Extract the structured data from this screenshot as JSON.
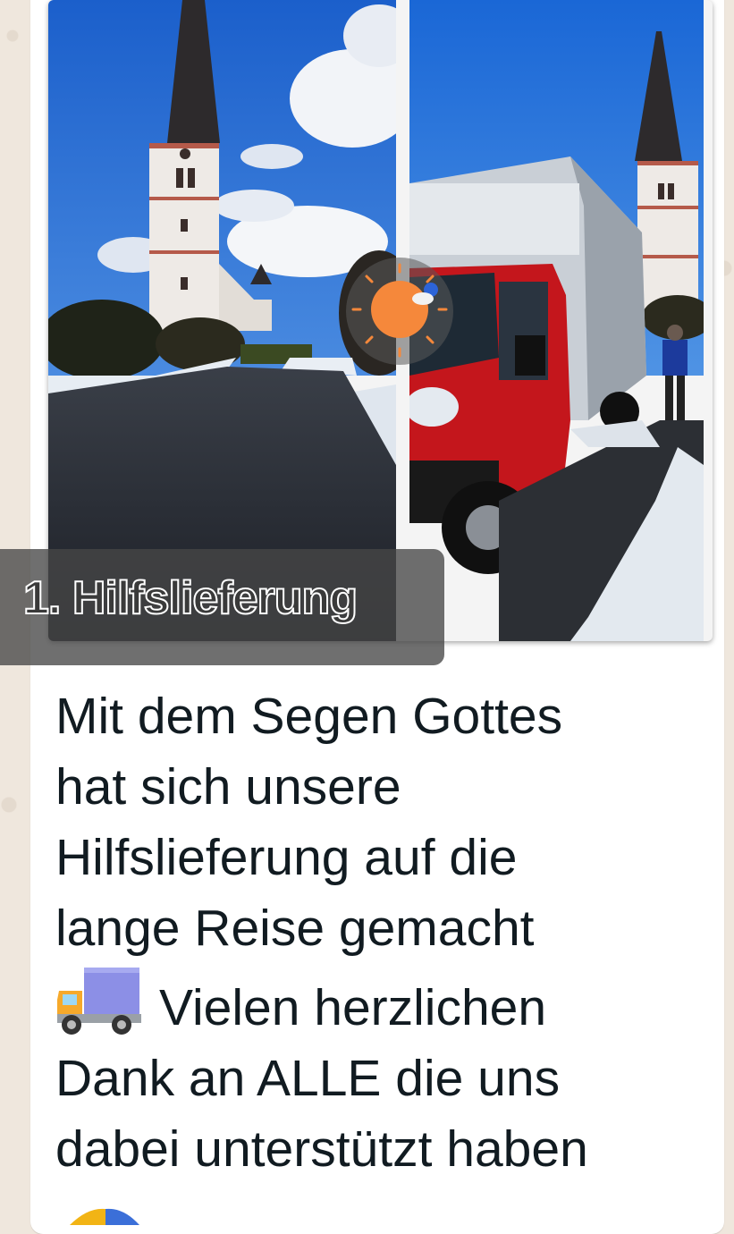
{
  "post": {
    "image_caption": "1. Hilfslieferung",
    "message_lines": [
      "Mit dem Segen Gottes",
      "hat sich unsere",
      "Hilfslieferung auf die",
      "lange Reise gemacht",
      "Vielen herzlichen",
      "Dank an ALLE die uns",
      "dabei unterstützt haben"
    ],
    "emojis": [
      "delivery-truck",
      "partial-emoji"
    ]
  },
  "colors": {
    "sky": "#1f6fd8",
    "truck_red": "#c4161c",
    "sun": "#f5883b",
    "bubble": "#ffffff",
    "wallpaper": "#efe7dd"
  }
}
